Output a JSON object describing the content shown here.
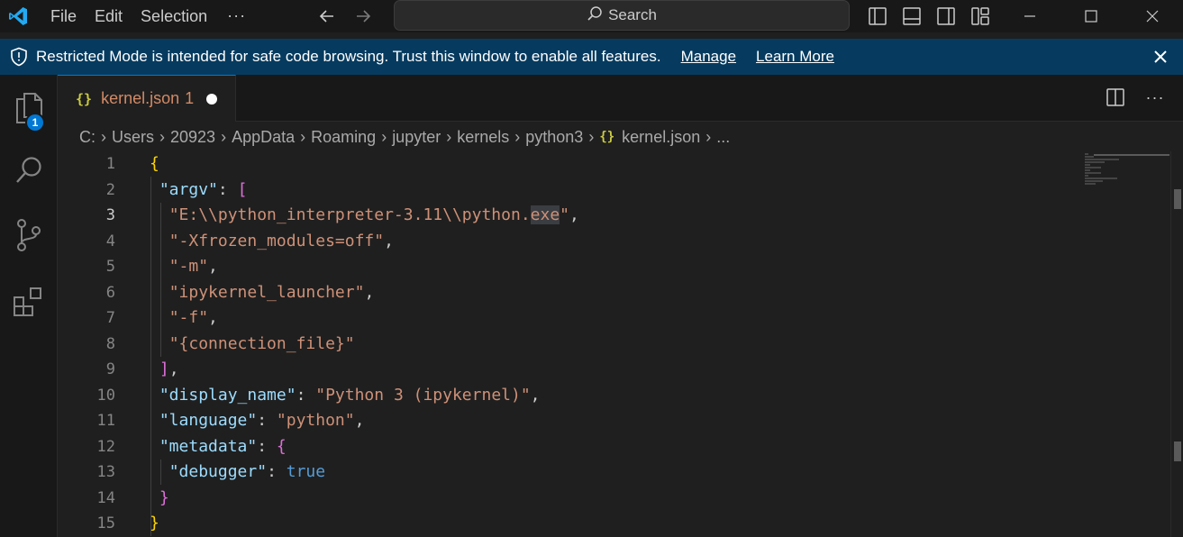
{
  "titlebar": {
    "menu": [
      "File",
      "Edit",
      "Selection"
    ],
    "more_label": "···",
    "search_label": "Search"
  },
  "banner": {
    "text": "Restricted Mode is intended for safe code browsing. Trust this window to enable all features.",
    "manage_label": "Manage",
    "learn_more_label": "Learn More",
    "background_color": "#063b5f"
  },
  "activitybar": {
    "explorer_badge": "1"
  },
  "tab": {
    "icon": "{}",
    "title": "kernel.json",
    "problem_count": "1"
  },
  "editor_actions": {
    "more_label": "···"
  },
  "breadcrumb": {
    "segments": [
      "C:",
      "Users",
      "20923",
      "AppData",
      "Roaming",
      "jupyter",
      "kernels",
      "python3"
    ],
    "file_icon": "{}",
    "file": "kernel.json",
    "trailing": "..."
  },
  "editor": {
    "line_numbers": [
      "1",
      "2",
      "3",
      "4",
      "5",
      "6",
      "7",
      "8",
      "9",
      "10",
      "11",
      "12",
      "13",
      "14",
      "15"
    ],
    "lines": {
      "l1": "{",
      "l2_key": "\"argv\"",
      "l2_sep": ": ",
      "l2_open": "[",
      "l3_pre": "\"E:\\\\python_interpreter-3.11\\\\python.",
      "l3_hl": "exe",
      "l3_post": "\"",
      "l3_comma": ",",
      "l4": "\"-Xfrozen_modules=off\"",
      "l4_comma": ",",
      "l5": "\"-m\"",
      "l5_comma": ",",
      "l6": "\"ipykernel_launcher\"",
      "l6_comma": ",",
      "l7": "\"-f\"",
      "l7_comma": ",",
      "l8": "\"{connection_file}\"",
      "l9_close": "]",
      "l9_comma": ",",
      "l10_key": "\"display_name\"",
      "l10_sep": ": ",
      "l10_val": "\"Python 3 (ipykernel)\"",
      "l10_comma": ",",
      "l11_key": "\"language\"",
      "l11_sep": ": ",
      "l11_val": "\"python\"",
      "l11_comma": ",",
      "l12_key": "\"metadata\"",
      "l12_sep": ": ",
      "l12_open": "{",
      "l13_key": "\"debugger\"",
      "l13_sep": ": ",
      "l13_val": "true",
      "l14_close": "}",
      "l15": "}"
    }
  },
  "colors": {
    "accent": "#0078d4",
    "json_key": "#9cdcfe",
    "json_string": "#ce9178",
    "json_bool": "#569cd6",
    "bracket_level1": "#ffd700",
    "bracket_level2": "#da70d6"
  }
}
